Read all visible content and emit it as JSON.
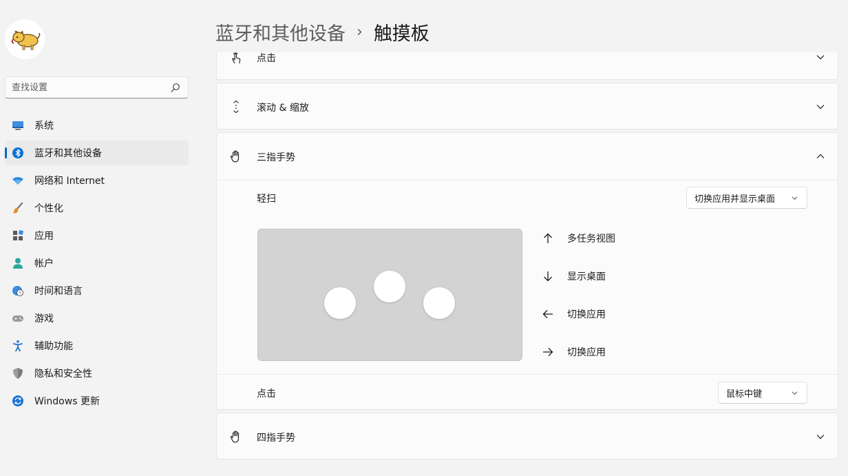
{
  "sidebar": {
    "search": {
      "placeholder": "查找设置"
    },
    "items": [
      {
        "label": "系统",
        "icon": "monitor-icon"
      },
      {
        "label": "蓝牙和其他设备",
        "icon": "bluetooth-icon",
        "active": true
      },
      {
        "label": "网络和 Internet",
        "icon": "wifi-icon"
      },
      {
        "label": "个性化",
        "icon": "brush-icon"
      },
      {
        "label": "应用",
        "icon": "apps-icon"
      },
      {
        "label": "帐户",
        "icon": "account-icon"
      },
      {
        "label": "时间和语言",
        "icon": "globe-clock-icon"
      },
      {
        "label": "游戏",
        "icon": "gamepad-icon"
      },
      {
        "label": "辅助功能",
        "icon": "accessibility-icon"
      },
      {
        "label": "隐私和安全性",
        "icon": "shield-icon"
      },
      {
        "label": "Windows 更新",
        "icon": "update-icon"
      }
    ]
  },
  "header": {
    "parent": "蓝牙和其他设备",
    "separator": "›",
    "current": "触摸板"
  },
  "main": {
    "tap_section": {
      "title": "点击",
      "expanded": false
    },
    "scroll_zoom_section": {
      "title": "滚动 & 缩放",
      "expanded": false
    },
    "three_finger_section": {
      "title": "三指手势",
      "expanded": true,
      "swipe": {
        "label": "轻扫",
        "value": "切换应用并显示桌面"
      },
      "gestures": [
        {
          "direction": "up",
          "label": "多任务视图"
        },
        {
          "direction": "down",
          "label": "显示桌面"
        },
        {
          "direction": "left",
          "label": "切换应用"
        },
        {
          "direction": "right",
          "label": "切换应用"
        }
      ],
      "tap": {
        "label": "点击",
        "value": "鼠标中键"
      }
    },
    "four_finger_section": {
      "title": "四指手势",
      "expanded": false
    }
  },
  "colors": {
    "accent": "#0067c0",
    "background": "#f3f3f3",
    "card": "#fbfbfb",
    "touchpad": "#d3d3d3"
  }
}
